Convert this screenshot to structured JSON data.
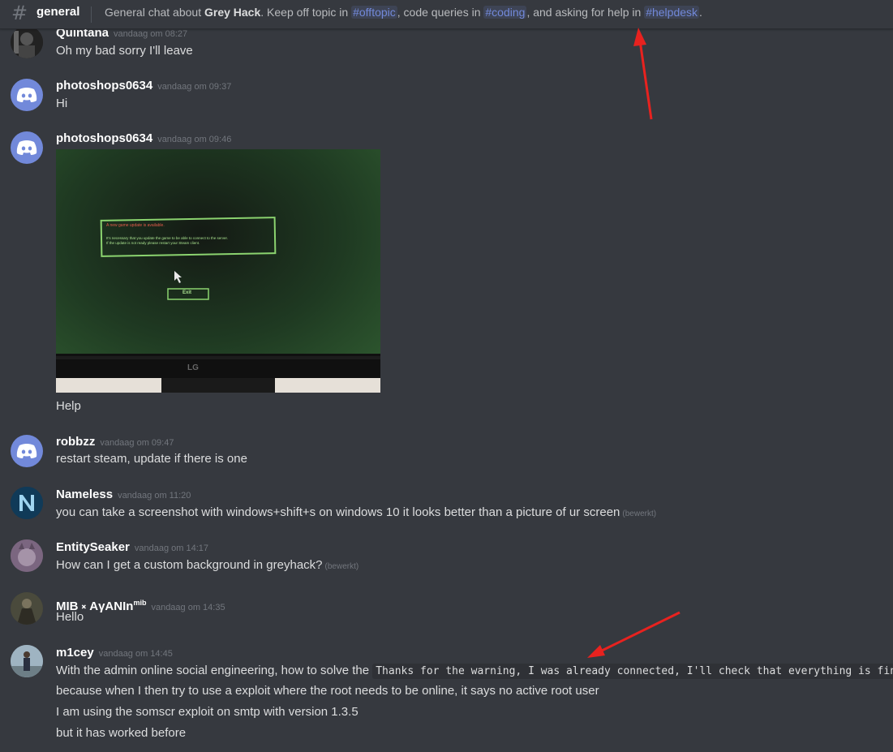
{
  "channel": {
    "name": "general",
    "topic_prefix": "General chat about ",
    "topic_bold": "Grey Hack",
    "topic_mid1": ". Keep off topic in ",
    "mention1": "#offtopic",
    "topic_mid2": ", code queries in ",
    "mention2": "#coding",
    "topic_mid3": ", and asking for help in ",
    "mention3": "#helpdesk",
    "topic_end": "."
  },
  "messages": [
    {
      "user": "Quintana",
      "time": "vandaag om 08:27",
      "text": "Oh my bad sorry I'll leave"
    },
    {
      "user": "photoshops0634",
      "time": "vandaag om 09:37",
      "text": "Hi"
    },
    {
      "user": "photoshops0634",
      "time": "vandaag om 09:46",
      "text": "Help"
    },
    {
      "user": "robbzz",
      "time": "vandaag om 09:47",
      "text": "restart steam, update if there is one"
    },
    {
      "user": "Nameless",
      "time": "vandaag om 11:20",
      "text": "you can take a screenshot with windows+shift+s on windows 10 it looks better than a picture of ur screen",
      "edited": "(bewerkt)"
    },
    {
      "user": "EntitySeaker",
      "time": "vandaag om 14:17",
      "text": "How can I get a custom background in greyhack?",
      "edited": "(bewerkt)"
    },
    {
      "user": "MIB ༝ AγANIn",
      "user_sup": "mib",
      "time": "vandaag om 14:35",
      "text": "Hello"
    },
    {
      "user": "m1cey",
      "time": "vandaag om 14:45",
      "text": "With the admin online social engineering, how to solve the",
      "code": "Thanks for the warning, I was already connected, I'll check that everything is fine.",
      "line2": "because when I then try to use a exploit where the root needs to be online, it says no active root user",
      "line3": "I am using the somscr exploit on smtp with version 1.3.5",
      "line4": "but it has worked before"
    }
  ],
  "attachment": {
    "dialog_title": "A new game update is available.",
    "dialog_line1": "It's necessary that you update the game to be able to connect to the server.",
    "dialog_line2": "If the update is not ready please restart your Steam client.",
    "exit_label": "Exit",
    "monitor_brand": "LG"
  },
  "colors": {
    "background": "#36393f",
    "mention": "#7289da",
    "arrow": "#e8221f"
  }
}
